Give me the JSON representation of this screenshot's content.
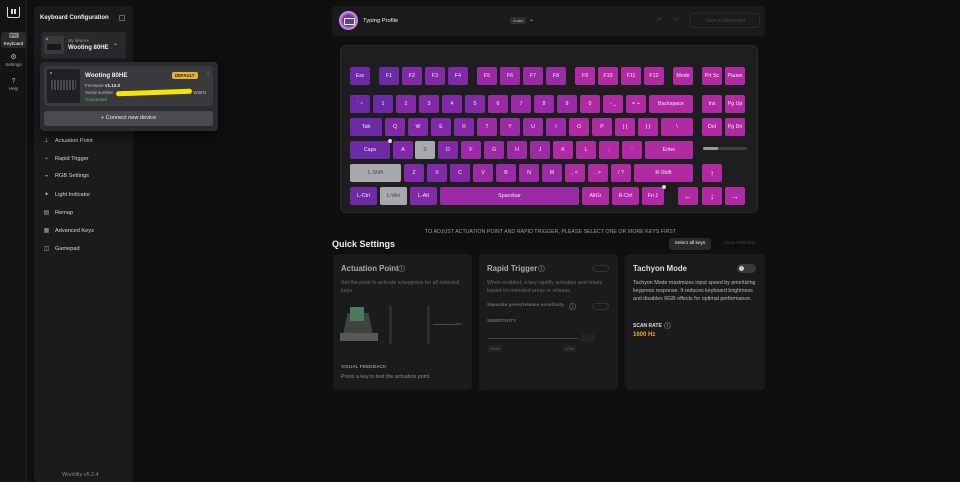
{
  "rail": {
    "items": [
      {
        "label": "Keyboard",
        "icon": "keyboard-icon"
      },
      {
        "label": "Settings",
        "icon": "gear-icon"
      },
      {
        "label": "Help",
        "icon": "help-icon"
      }
    ]
  },
  "sidebar": {
    "title": "Keyboard Configuration",
    "device_label": "My devices",
    "device_name": "Wooting 80HE",
    "menu": [
      {
        "label": "Actuation Point",
        "icon": "actuation-icon"
      },
      {
        "label": "Rapid Trigger",
        "icon": "rapid-trigger-icon"
      },
      {
        "label": "RGB Settings",
        "icon": "rgb-icon"
      },
      {
        "label": "Light Indicator",
        "icon": "light-indicator-icon"
      },
      {
        "label": "Remap",
        "icon": "remap-icon"
      },
      {
        "label": "Advanced Keys",
        "icon": "advanced-keys-icon"
      },
      {
        "label": "Gamepad",
        "icon": "gamepad-icon"
      }
    ],
    "version": "Wootility v5.2.4"
  },
  "popup": {
    "name": "Wooting 80HE",
    "badge": "DEFAULT",
    "firmware_label": "Firmware",
    "firmware_value": "v1.12.0",
    "serial_label": "Serial number",
    "serial_value": "W8EN",
    "status": "Connected",
    "connect_button": "+ Connect new device"
  },
  "topbar": {
    "profile_name": "Typing Profile",
    "profile_badge": "Audio",
    "save_button": "Save to Keyboard"
  },
  "keyboard": {
    "rows": [
      [
        "Esc",
        "F1",
        "F2",
        "F3",
        "F4",
        "F5",
        "F6",
        "F7",
        "F8",
        "F9",
        "F10",
        "F11",
        "F12",
        "Mode",
        "Prt Sc",
        "Pause"
      ],
      [
        "` ~",
        "1",
        "2",
        "3",
        "4",
        "5",
        "6",
        "7",
        "8",
        "9",
        "0",
        "- _",
        "= +",
        "Backspace",
        "Ins",
        "Pg Up"
      ],
      [
        "Tab",
        "Q",
        "W",
        "E",
        "R",
        "T",
        "Y",
        "U",
        "I",
        "O",
        "P",
        "[ {",
        "] }",
        "\\",
        "Del",
        "Pg Dn"
      ],
      [
        "Caps",
        "A",
        "S",
        "D",
        "F",
        "G",
        "H",
        "J",
        "K",
        "L",
        ";",
        ";",
        "'",
        "Enter"
      ],
      [
        "L-Shift",
        "Z",
        "X",
        "C",
        "V",
        "B",
        "N",
        "M",
        ", <",
        ". >",
        "/ ?",
        "R-Shift",
        "↑"
      ],
      [
        "L-Ctrl",
        "L-Win",
        "L-Alt",
        "Spacebar",
        "AltGr",
        "R-Ctrl",
        "Fn 1",
        "←",
        "↓",
        "→"
      ]
    ]
  },
  "hint": "TO ADJUST ACTUATION POINT AND RAPID TRIGGER, PLEASE SELECT ONE OR MORE KEYS FIRST",
  "quick_settings": {
    "title": "Quick Settings",
    "select_all": "Select all keys",
    "clear_selection": "Clear selection",
    "actuation": {
      "title": "Actuation Point",
      "desc": "Set the point to activate a keypress for all selected keys.",
      "mm": "mm",
      "visual_feedback": "VISUAL FEEDBACK",
      "visual_desc": "Press a key to test the actuation point."
    },
    "rapid": {
      "title": "Rapid Trigger",
      "desc": "When enabled, a key rapidly activates and resets based on intended press or release.",
      "separate": "Separate press/release sensitivity",
      "sensitivity": "SENSITIVITY",
      "high": "HIGH",
      "low": "LOW"
    },
    "tachyon": {
      "title": "Tachyon Mode",
      "desc": "Tachyon Mode maximizes input speed by prioritizing keypress response. It reduces keyboard brightness and disables RGB effects for optimal performance.",
      "scan_label": "SCAN RATE",
      "scan_value": "1600 Hz"
    }
  }
}
